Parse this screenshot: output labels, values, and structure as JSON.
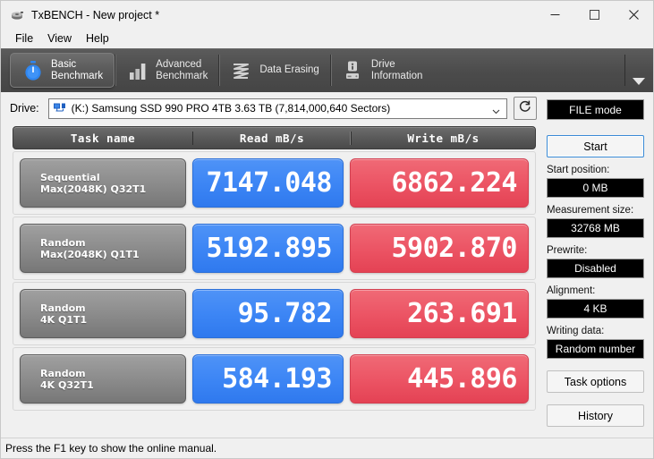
{
  "window": {
    "title": "TxBENCH - New project *",
    "icon": "app-icon",
    "minimize": "─",
    "maximize": "□",
    "close": "✕"
  },
  "menu": [
    {
      "label": "File"
    },
    {
      "label": "View"
    },
    {
      "label": "Help"
    }
  ],
  "tabs": [
    {
      "label": "Basic\nBenchmark",
      "icon": "stopwatch-icon",
      "active": true
    },
    {
      "label": "Advanced\nBenchmark",
      "icon": "bar-chart-icon",
      "active": false
    },
    {
      "label": "Data Erasing",
      "icon": "shred-icon",
      "active": false
    },
    {
      "label": "Drive\nInformation",
      "icon": "drive-info-icon",
      "active": false
    }
  ],
  "tab_overflow_icon": "chevron-down-icon",
  "drive": {
    "label": "Drive:",
    "icon": "network-drive-icon",
    "value": "(K:) Samsung SSD 990 PRO 4TB  3.63 TB (7,814,000,640 Sectors)",
    "dropdown_icon": "chevron-down-icon",
    "refresh_icon": "refresh-icon"
  },
  "results": {
    "headers": {
      "task": "Task name",
      "read": "Read mB/s",
      "write": "Write mB/s"
    },
    "rows": [
      {
        "task_line1": "Sequential",
        "task_line2": "Max(2048K) Q32T1",
        "read": "7147.048",
        "write": "6862.224"
      },
      {
        "task_line1": "Random",
        "task_line2": "Max(2048K) Q1T1",
        "read": "5192.895",
        "write": "5902.870"
      },
      {
        "task_line1": "Random",
        "task_line2": "4K Q1T1",
        "read": "95.782",
        "write": "263.691"
      },
      {
        "task_line1": "Random",
        "task_line2": "4K Q32T1",
        "read": "584.193",
        "write": "445.896"
      }
    ]
  },
  "controls": {
    "mode": "FILE mode",
    "start_button": "Start",
    "start_position_label": "Start position:",
    "start_position_value": "0 MB",
    "measurement_size_label": "Measurement size:",
    "measurement_size_value": "32768 MB",
    "prewrite_label": "Prewrite:",
    "prewrite_value": "Disabled",
    "alignment_label": "Alignment:",
    "alignment_value": "4 KB",
    "writing_data_label": "Writing data:",
    "writing_data_value": "Random number",
    "task_options_button": "Task options",
    "history_button": "History"
  },
  "statusbar": {
    "text": "Press the F1 key to show the online manual."
  },
  "colors": {
    "read_blue": "#3d86f5",
    "write_red": "#ec5565",
    "tab_bar": "#4b4b4b",
    "task_grey": "#8e8e8e"
  },
  "chart_data": {
    "type": "table",
    "title": "TxBENCH Basic Benchmark Results",
    "columns": [
      "Task name",
      "Read mB/s",
      "Write mB/s"
    ],
    "categories": [
      "Sequential Max(2048K) Q32T1",
      "Random Max(2048K) Q1T1",
      "Random 4K Q1T1",
      "Random 4K Q32T1"
    ],
    "series": [
      {
        "name": "Read mB/s",
        "values": [
          7147.048,
          5192.895,
          95.782,
          584.193
        ]
      },
      {
        "name": "Write mB/s",
        "values": [
          6862.224,
          5902.87,
          263.691,
          445.896
        ]
      }
    ],
    "units": "mB/s"
  }
}
